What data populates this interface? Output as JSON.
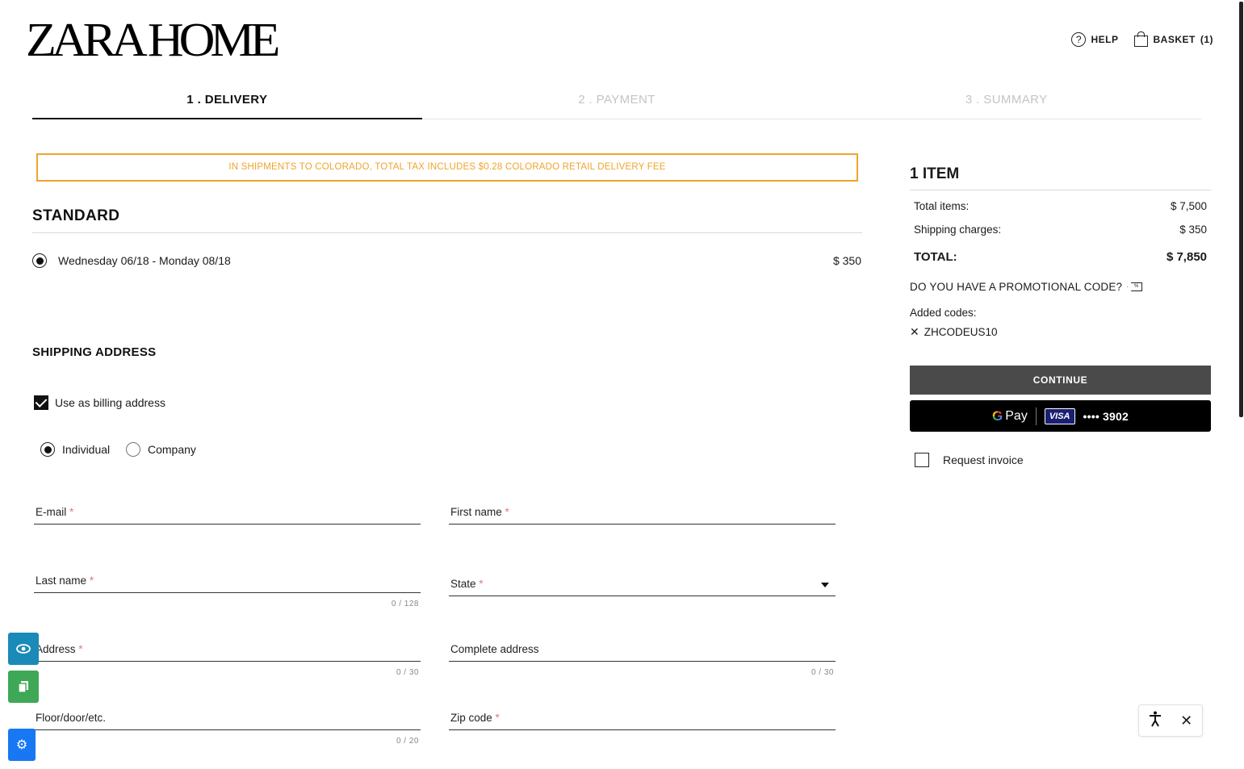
{
  "header": {
    "logo": "ZARA HOME",
    "help_label": "HELP",
    "basket_label": "BASKET",
    "basket_count": "(1)"
  },
  "steps": [
    {
      "label": "1 . DELIVERY",
      "active": true
    },
    {
      "label": "2 . PAYMENT",
      "active": false
    },
    {
      "label": "3 . SUMMARY",
      "active": false
    }
  ],
  "notice": "IN SHIPMENTS TO COLORADO, TOTAL TAX INCLUDES $0.28 COLORADO RETAIL DELIVERY FEE",
  "delivery": {
    "title": "STANDARD",
    "option_label": "Wednesday 06/18 - Monday 08/18",
    "option_price": "$ 350"
  },
  "shipping": {
    "title": "SHIPPING ADDRESS",
    "billing_checkbox_label": "Use as billing address",
    "type_individual": "Individual",
    "type_company": "Company",
    "fields": {
      "email": "E-mail",
      "first_name": "First name",
      "last_name": "Last name",
      "last_name_counter": "0 / 128",
      "state": "State",
      "address": "Address",
      "address_counter": "0 / 30",
      "complete_address": "Complete address",
      "complete_address_counter": "0 / 30",
      "floor": "Floor/door/etc.",
      "floor_counter": "0 / 20",
      "zip": "Zip code"
    },
    "required_mark": "*"
  },
  "summary": {
    "title": "1 ITEM",
    "total_items_label": "Total items:",
    "total_items_value": "$ 7,500",
    "shipping_label": "Shipping charges:",
    "shipping_value": "$ 350",
    "total_label": "TOTAL:",
    "total_value": "$ 7,850",
    "promo_label": "DO YOU HAVE A PROMOTIONAL CODE?",
    "added_codes_label": "Added codes:",
    "code": "ZHCODEUS10",
    "continue_label": "CONTINUE",
    "gpay_label": "Pay",
    "card_brand": "VISA",
    "card_number": "•••• 3902",
    "request_invoice_label": "Request invoice"
  },
  "colors": {
    "notice_orange": "#f0a42b",
    "continue_bg": "#4a4a4a",
    "side_eye": "#1a8ab8",
    "side_copy": "#3fa857",
    "side_gear": "#1877f2"
  }
}
